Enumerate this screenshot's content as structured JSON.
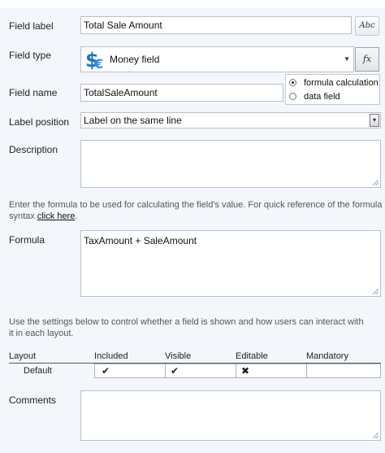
{
  "field_label": {
    "label": "Field label",
    "value": "Total Sale Amount",
    "abc_button": "Abc"
  },
  "field_type": {
    "label": "Field type",
    "value": "Money field",
    "type_icon": "dollar-euro-icon",
    "fx_button": "fx",
    "popup_options": [
      {
        "label": "formula calculation",
        "selected": true
      },
      {
        "label": "data field",
        "selected": false
      }
    ]
  },
  "field_name": {
    "label": "Field name",
    "value": "TotalSaleAmount"
  },
  "label_position": {
    "label": "Label position",
    "value": "Label on the same line"
  },
  "description": {
    "label": "Description",
    "value": ""
  },
  "formula_hint": {
    "text": "Enter the formula to be used for calculating the field's value. For quick reference of the formula syntax",
    "link": "click here",
    "suffix": "."
  },
  "formula": {
    "label": "Formula",
    "value": "TaxAmount + SaleAmount"
  },
  "layout_hint": "Use the settings below to control whether a field is shown and how users can interact with it in each layout.",
  "layout_table": {
    "headers": [
      "Layout",
      "Included",
      "Visible",
      "Editable",
      "Mandatory"
    ],
    "rows": [
      {
        "layout": "Default",
        "included": "✔",
        "visible": "✔",
        "editable": "✖",
        "mandatory": ""
      }
    ]
  },
  "comments": {
    "label": "Comments",
    "value": ""
  },
  "colors": {
    "panel_bg": "#f3f6fa",
    "border": "#b9c0c8",
    "dollar_blue": "#1c74c9"
  }
}
